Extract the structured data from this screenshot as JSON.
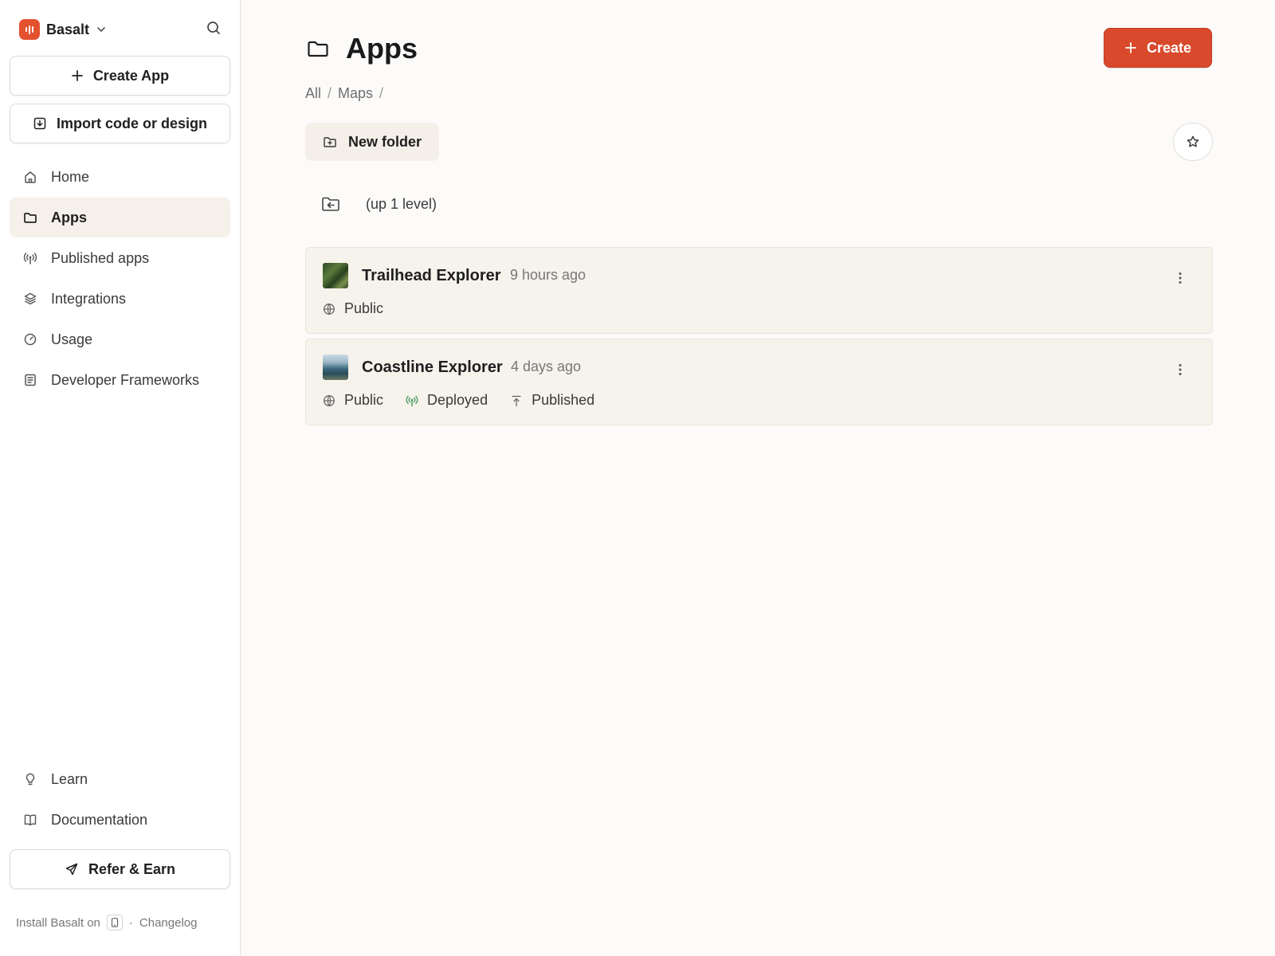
{
  "brand": {
    "name": "Basalt",
    "accent_color": "#e4512f"
  },
  "sidebar": {
    "create_app_label": "Create App",
    "import_label": "Import code or design",
    "items": [
      {
        "label": "Home",
        "icon": "home-icon"
      },
      {
        "label": "Apps",
        "icon": "folder-icon",
        "active": true
      },
      {
        "label": "Published apps",
        "icon": "broadcast-icon"
      },
      {
        "label": "Integrations",
        "icon": "layers-icon"
      },
      {
        "label": "Usage",
        "icon": "gauge-icon"
      },
      {
        "label": "Developer Frameworks",
        "icon": "document-icon"
      }
    ],
    "bottom_items": [
      {
        "label": "Learn",
        "icon": "lightbulb-icon"
      },
      {
        "label": "Documentation",
        "icon": "book-icon"
      }
    ],
    "refer_label": "Refer & Earn",
    "footer": {
      "install_text": "Install Basalt on",
      "separator": "·",
      "changelog": "Changelog"
    }
  },
  "main": {
    "title": "Apps",
    "create_label": "Create",
    "create_color": "#d9492b",
    "breadcrumb": [
      "All",
      "Maps"
    ],
    "breadcrumb_sep": "/",
    "new_folder_label": "New folder",
    "up_level_label": "(up 1 level)",
    "apps": [
      {
        "name": "Trailhead Explorer",
        "time": "9 hours ago",
        "tags": [
          {
            "label": "Public",
            "icon": "globe-icon"
          }
        ]
      },
      {
        "name": "Coastline Explorer",
        "time": "4 days ago",
        "tags": [
          {
            "label": "Public",
            "icon": "globe-icon"
          },
          {
            "label": "Deployed",
            "icon": "broadcast-icon",
            "color": "#3d9a55"
          },
          {
            "label": "Published",
            "icon": "upload-icon"
          }
        ]
      }
    ]
  }
}
